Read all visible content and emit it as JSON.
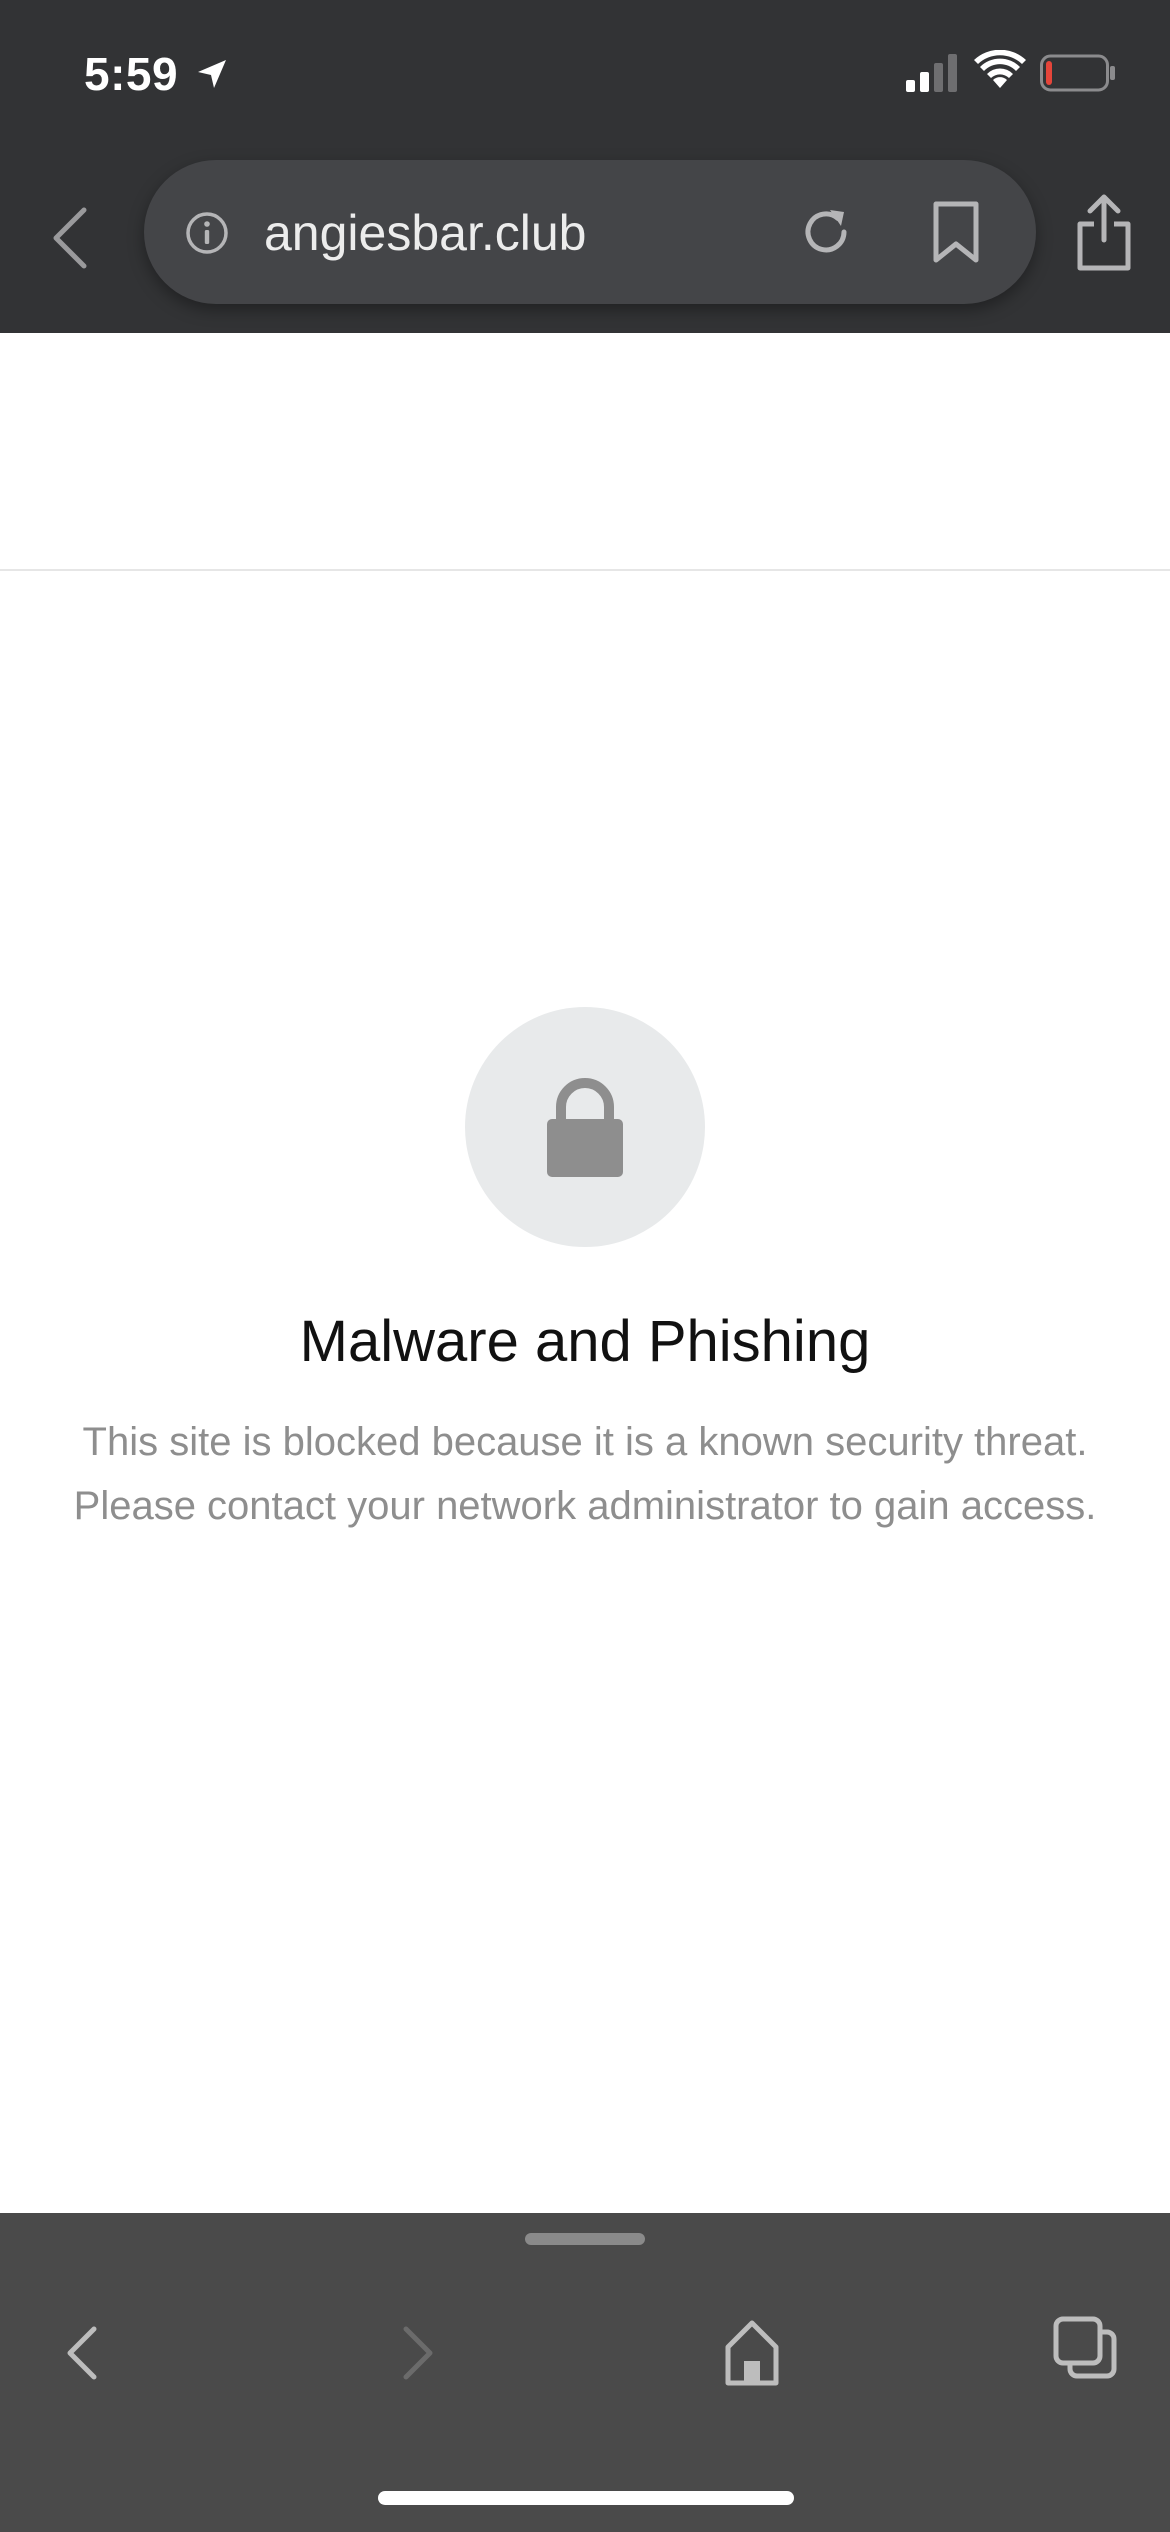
{
  "status_bar": {
    "time": "5:59",
    "icons": [
      "location-arrow-icon",
      "cellular-signal-icon",
      "wifi-icon",
      "battery-low-icon"
    ],
    "battery_level": 0.1,
    "battery_color": "#e5453a"
  },
  "toolbar": {
    "url": "angiesbar.club",
    "icons": [
      "back-chevron-icon",
      "info-icon",
      "reload-icon",
      "bookmark-icon",
      "share-icon"
    ]
  },
  "block_page": {
    "title": "Malware and Phishing",
    "message_line1": "This site is blocked because it is a known security threat.",
    "message_line2": "Please contact your network administrator to gain access.",
    "icon": "lock-icon"
  },
  "bottom_toolbar": {
    "icons": [
      "back-icon",
      "forward-icon",
      "home-icon",
      "tabs-icon"
    ]
  },
  "colors": {
    "chrome_background": "#323335",
    "url_pill": "#444548",
    "bottom_toolbar": "#4a4a4a",
    "lock_circle": "#e8eaeb",
    "lock": "#8e8e8e",
    "message_text": "#8e8e8e"
  }
}
